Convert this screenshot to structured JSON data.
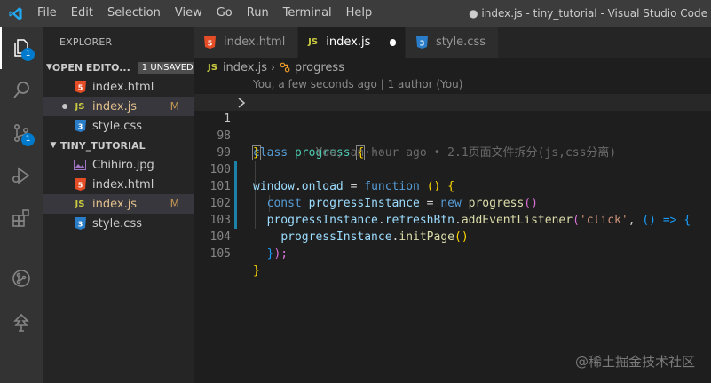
{
  "menu": [
    "File",
    "Edit",
    "Selection",
    "View",
    "Go",
    "Run",
    "Terminal",
    "Help"
  ],
  "window_title": "● index.js - tiny_tutorial - Visual Studio Code",
  "activity": {
    "explorer_badge": "1",
    "scm_badge": "1"
  },
  "explorer": {
    "title": "EXPLORER",
    "open_editors": {
      "label": "OPEN EDITO...",
      "unsaved": "1 UNSAVED",
      "items": [
        {
          "name": "index.html",
          "type": "html"
        },
        {
          "name": "index.js",
          "type": "js",
          "status": "M"
        },
        {
          "name": "style.css",
          "type": "css"
        }
      ]
    },
    "workspace": {
      "label": "TINY_TUTORIAL",
      "items": [
        {
          "name": "Chihiro.jpg",
          "type": "img"
        },
        {
          "name": "index.html",
          "type": "html"
        },
        {
          "name": "index.js",
          "type": "js",
          "status": "M"
        },
        {
          "name": "style.css",
          "type": "css"
        }
      ]
    }
  },
  "tabs": [
    {
      "label": "index.html",
      "type": "html"
    },
    {
      "label": "index.js",
      "type": "js"
    },
    {
      "label": "style.css",
      "type": "css"
    }
  ],
  "breadcrumb": {
    "file": "index.js",
    "symbol": "progress"
  },
  "editor": {
    "codelens": "You, a few seconds ago | 1 author (You)",
    "inline_blame": "You, an hour ago • 2.1页面文件拆分(js,css分离)",
    "line_numbers": [
      "1",
      "98",
      "99",
      "100",
      "101",
      "102",
      "103",
      "104",
      "105"
    ],
    "tokens": {
      "class_kw": "class",
      "class_name": "progress",
      "brace_open": "{",
      "ellipsis": "···",
      "brace_close": "}",
      "window": "window",
      "onload": "onload",
      "eq": " = ",
      "function_kw": "function",
      "arrow_paren": " () ",
      "const_kw": "const",
      "instance": "progressInstance",
      "new_kw": "new",
      "call": "()",
      "refresh": "refreshBtn",
      "add_listener": "addEventListener",
      "click_str": "'click'",
      "arrow": "() =>",
      "init_page": "initPage",
      "close_paren_semi": ");"
    }
  },
  "watermark": "@稀土掘金技术社区",
  "icon_letters": {
    "js": "JS",
    "html": "5",
    "css": "3"
  }
}
